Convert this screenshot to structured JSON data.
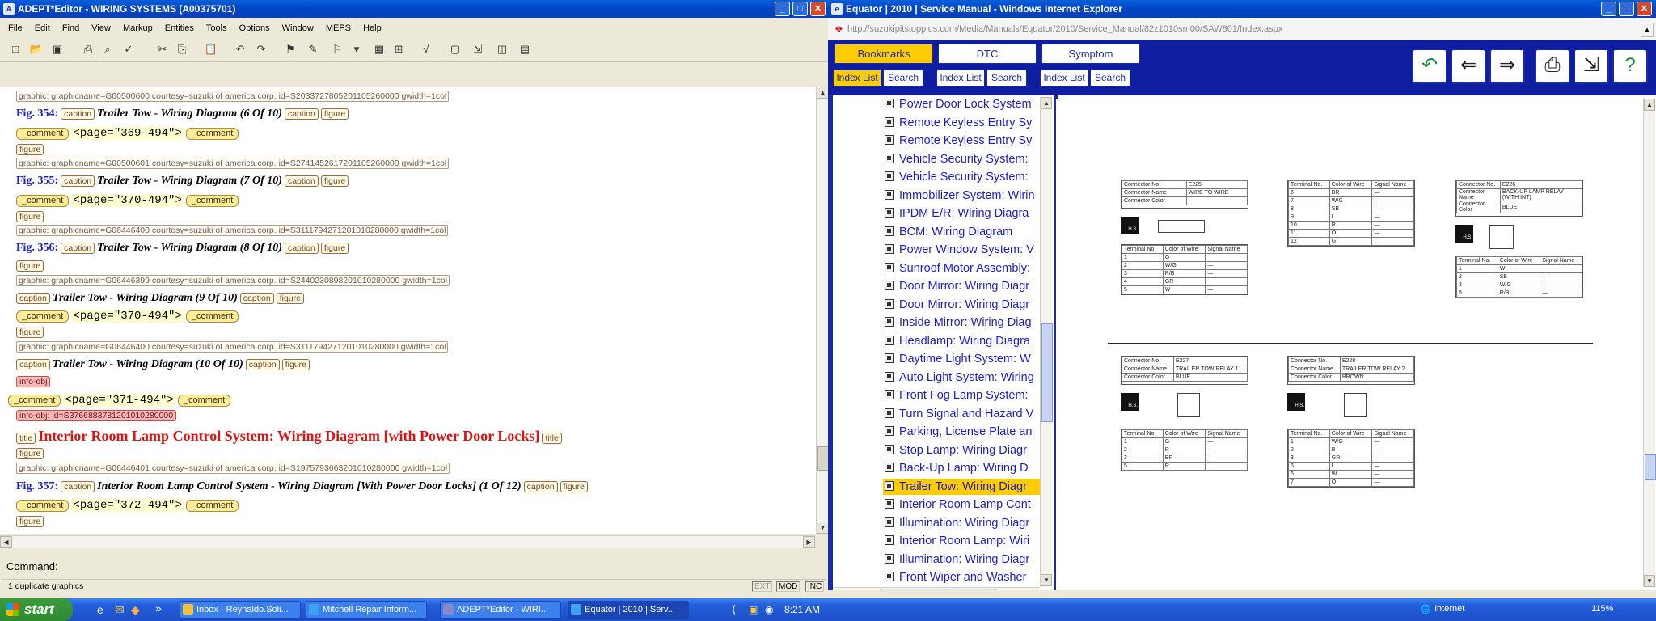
{
  "adept": {
    "title": "ADEPT*Editor - WIRING SYSTEMS (A00375701)",
    "menu": [
      "File",
      "Edit",
      "Find",
      "View",
      "Markup",
      "Entities",
      "Tools",
      "Options",
      "Window",
      "MEPS",
      "Help"
    ],
    "lines": {
      "g1": "graphic: graphicname=G00500600 courtesy=suzuki of america corp. id=S2033727805201105260000 gwidth=1col",
      "f354_label": "Fig. 354:",
      "f354_caption": "Trailer Tow - Wiring Diagram (6 Of 10)",
      "page369": "<page=\"369-494\">",
      "g2": "graphic: graphicname=G00500601 courtesy=suzuki of america corp. id=S2741452617201105260000 gwidth=1col",
      "f355_label": "Fig. 355:",
      "f355_caption": "Trailer Tow - Wiring Diagram (7 Of 10)",
      "page370a": "<page=\"370-494\">",
      "g3": "graphic: graphicname=G06446400 courtesy=suzuki of america corp. id=S3111794271201010280000 gwidth=1col",
      "f356_label": "Fig. 356:",
      "f356_caption": "Trailer Tow - Wiring Diagram (8 Of 10)",
      "g4": "graphic: graphicname=G06446399 courtesy=suzuki of america corp. id=S2440230898201010280000 gwidth=1col",
      "cap9": "Trailer Tow - Wiring Diagram (9 Of 10)",
      "page370b": "<page=\"370-494\">",
      "g5": "graphic: graphicname=G06446400 courtesy=suzuki of america corp. id=S3111794271201010280000 gwidth=1col",
      "cap10": "Trailer Tow - Wiring Diagram (10 Of 10)",
      "info1": "info-obj",
      "page371": "<page=\"371-494\">",
      "info2": "info-obj: id=S3766883781201010280000",
      "title_text": "Interior Room Lamp Control System: Wiring Diagram [with Power Door Locks]",
      "g6": "graphic: graphicname=G06446401 courtesy=suzuki of america corp. id=S1975793663201010280000 gwidth=1col",
      "f357_label": "Fig. 357:",
      "f357_caption": "Interior Room Lamp Control System - Wiring Diagram [With Power Door Locks] (1 Of 12)",
      "page372": "<page=\"372-494\">"
    },
    "tags": {
      "caption": "caption",
      "figure": "figure",
      "comment": "_comment",
      "title": "title"
    },
    "command_label": "Command:",
    "status": "1 duplicate graphics",
    "status_right": [
      "EXT",
      "MOD",
      "INC"
    ]
  },
  "ie": {
    "title": "Equator | 2010 | Service Manual - Windows Internet Explorer",
    "url": "http://suzukipitstopplus.com/Media/Manuals/Equator/2010/Service_Manual/82z1010sm00/SAW801/Index.aspx",
    "tabs": [
      "Bookmarks",
      "DTC",
      "Symptom"
    ],
    "sub": [
      "Index List",
      "Search",
      "Index List",
      "Search",
      "Index List",
      "Search"
    ],
    "nav": [
      "Power Door Lock System",
      "Remote Keyless Entry Sy",
      "Remote Keyless Entry Sy",
      "Vehicle Security System:",
      "Vehicle Security System:",
      "Immobilizer System: Wirin",
      "IPDM E/R: Wiring Diagra",
      "BCM: Wiring Diagram",
      "Power Window System: V",
      "Sunroof Motor Assembly:",
      "Door Mirror: Wiring Diagr",
      "Door Mirror: Wiring Diagr",
      "Inside Mirror: Wiring Diag",
      "Headlamp: Wiring Diagra",
      "Daytime Light System: W",
      "Auto Light System: Wiring",
      "Front Fog Lamp System:",
      "Turn Signal and Hazard V",
      "Parking, License Plate an",
      "Stop Lamp: Wiring Diagr",
      "Back-Up Lamp: Wiring D",
      "Trailer Tow: Wiring Diagr",
      "Interior Room Lamp Cont",
      "Illumination: Wiring Diagr",
      "Interior Room Lamp: Wiri",
      "Illumination: Wiring Diagr",
      "Front Wiper and Washer"
    ],
    "selected_index": 21,
    "status_zone": "Internet",
    "zoom": "115%",
    "cards": {
      "c1": {
        "no": "E225",
        "name": "WIRE TO WIRE",
        "color": ""
      },
      "c2": {
        "no": "E226",
        "name": "BACK-UP LAMP RELAY (WITH INT)",
        "color": "BLUE"
      },
      "c3": {
        "no": "E227",
        "name": "TRAILER TOW RELAY 1",
        "color": "BLUE"
      },
      "c4": {
        "no": "E228",
        "name": "TRAILER TOW RELAY 2",
        "color": "BROWN"
      }
    },
    "t1_rows": [
      [
        "1",
        "O",
        ""
      ],
      [
        "2",
        "W/G",
        "—"
      ],
      [
        "3",
        "R/B",
        "—"
      ],
      [
        "4",
        "GR",
        ""
      ],
      [
        "5",
        "W",
        "—"
      ]
    ],
    "t2_rows": [
      [
        "6",
        "BR",
        "—"
      ],
      [
        "7",
        "W/G",
        "—"
      ],
      [
        "8",
        "SB",
        "—"
      ],
      [
        "9",
        "L",
        "—"
      ],
      [
        "10",
        "R",
        "—"
      ],
      [
        "11",
        "O",
        "—"
      ],
      [
        "12",
        "G",
        ""
      ]
    ],
    "t3_rows": [
      [
        "1",
        "W",
        ""
      ],
      [
        "2",
        "SB",
        "—"
      ],
      [
        "3",
        "W/G",
        "—"
      ],
      [
        "5",
        "R/B",
        "—"
      ]
    ],
    "t4_rows": [
      [
        "1",
        "G",
        "—"
      ],
      [
        "2",
        "R",
        "—"
      ],
      [
        "3",
        "BR",
        ""
      ],
      [
        "5",
        "R",
        ""
      ]
    ],
    "t5_rows": [
      [
        "1",
        "W/G",
        "—"
      ],
      [
        "2",
        "B",
        "—"
      ],
      [
        "3",
        "GR",
        ""
      ],
      [
        "5",
        "L",
        "—"
      ],
      [
        "6",
        "W",
        "—"
      ],
      [
        "7",
        "O",
        "—"
      ]
    ],
    "labels": {
      "conn_no": "Connector No.",
      "conn_name": "Connector Name",
      "conn_color": "Connector Color",
      "term_no": "Terminal No.",
      "wire_color": "Color of Wire",
      "signal": "Signal Name",
      "hs": "H.S."
    }
  },
  "taskbar": {
    "start": "start",
    "tasks": [
      "Inbox - Reynaldo.Soli...",
      "Mitchell Repair Inform...",
      "ADEPT*Editor - WIRI...",
      "Equator | 2010 | Serv..."
    ],
    "clock": "8:21 AM"
  }
}
